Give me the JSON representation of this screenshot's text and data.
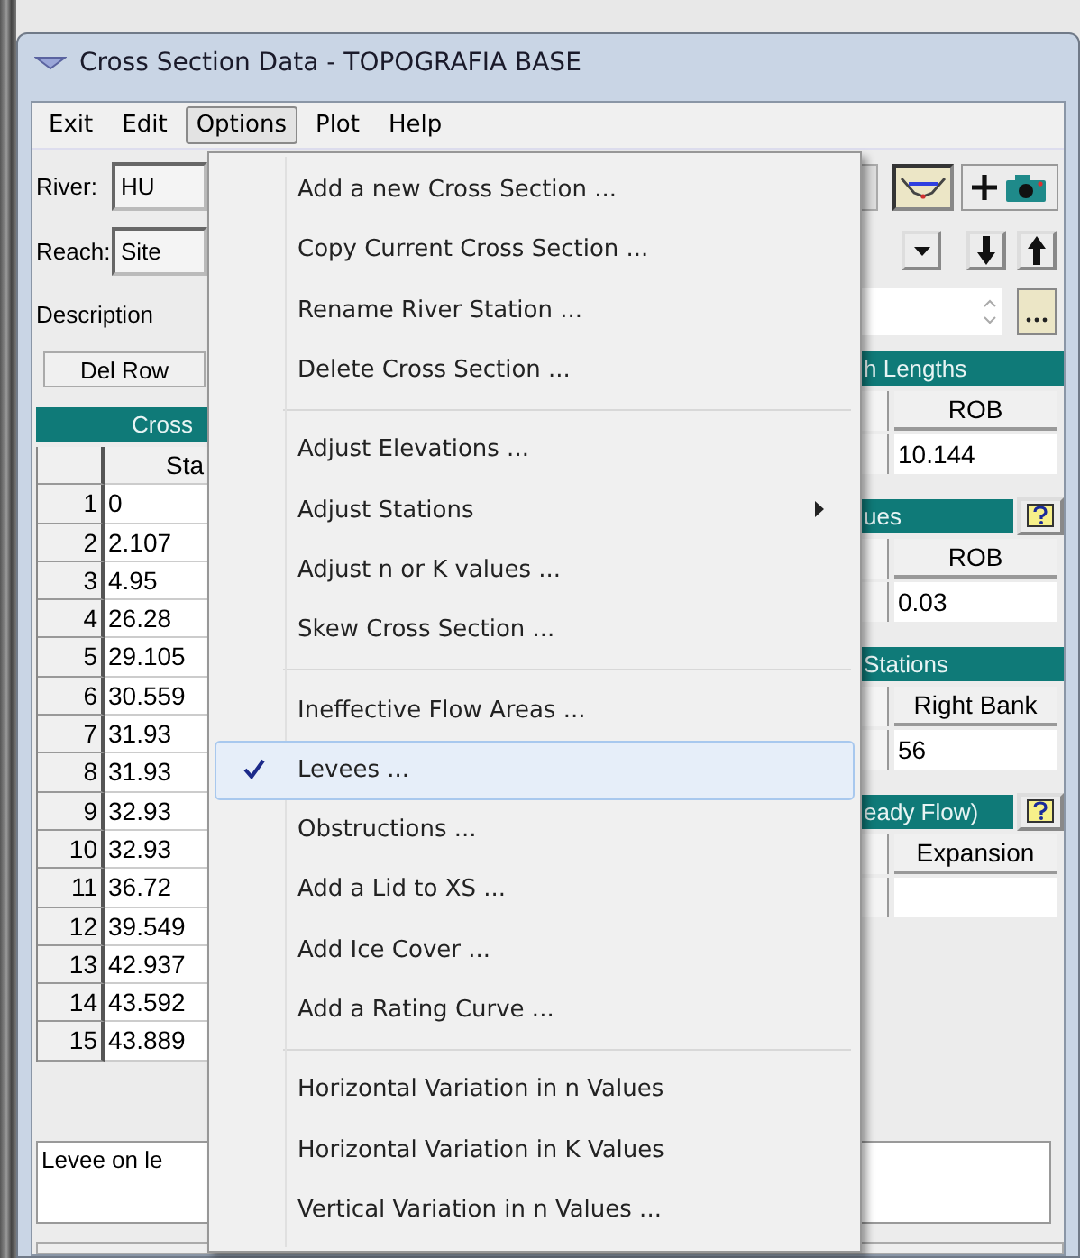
{
  "window": {
    "title": "Cross Section Data - TOPOGRAFIA BASE"
  },
  "menu_bar": [
    {
      "label": "Exit",
      "selected": false
    },
    {
      "label": "Edit",
      "selected": false
    },
    {
      "label": "Options",
      "selected": true
    },
    {
      "label": "Plot",
      "selected": false
    },
    {
      "label": "Help",
      "selected": false
    }
  ],
  "options_menu": {
    "groups": [
      [
        {
          "label": "Add a new Cross Section ...",
          "checked": false,
          "selected": false,
          "submenu": false
        },
        {
          "label": "Copy Current Cross Section ...",
          "checked": false,
          "selected": false,
          "submenu": false
        },
        {
          "label": "Rename River Station ...",
          "checked": false,
          "selected": false,
          "submenu": false
        },
        {
          "label": "Delete Cross Section ...",
          "checked": false,
          "selected": false,
          "submenu": false
        }
      ],
      [
        {
          "label": "Adjust Elevations ...",
          "checked": false,
          "selected": false,
          "submenu": false
        },
        {
          "label": "Adjust Stations",
          "checked": false,
          "selected": false,
          "submenu": true
        },
        {
          "label": "Adjust n or K values ...",
          "checked": false,
          "selected": false,
          "submenu": false
        },
        {
          "label": "Skew Cross Section ...",
          "checked": false,
          "selected": false,
          "submenu": false
        }
      ],
      [
        {
          "label": "Ineffective Flow Areas ...",
          "checked": false,
          "selected": false,
          "submenu": false
        },
        {
          "label": "Levees ...",
          "checked": true,
          "selected": true,
          "submenu": false
        },
        {
          "label": "Obstructions ...",
          "checked": false,
          "selected": false,
          "submenu": false
        },
        {
          "label": "Add a Lid to XS ...",
          "checked": false,
          "selected": false,
          "submenu": false
        },
        {
          "label": "Add Ice Cover ...",
          "checked": false,
          "selected": false,
          "submenu": false
        },
        {
          "label": "Add a Rating Curve ...",
          "checked": false,
          "selected": false,
          "submenu": false
        }
      ],
      [
        {
          "label": "Horizontal Variation in n Values",
          "checked": false,
          "selected": false,
          "submenu": false
        },
        {
          "label": "Horizontal Variation in K Values",
          "checked": false,
          "selected": false,
          "submenu": false
        },
        {
          "label": "Vertical Variation in n Values ...",
          "checked": false,
          "selected": false,
          "submenu": false
        }
      ]
    ]
  },
  "river": {
    "label": "River:",
    "value": "HU"
  },
  "reach": {
    "label": "Reach:",
    "value": "Site"
  },
  "description": {
    "label": "Description"
  },
  "del_row_button": "Del Row",
  "toolbar_buttons": [
    {
      "selected": false
    },
    {
      "selected": true
    },
    {
      "selected": false
    }
  ],
  "cross_section_table": {
    "title": "Cross",
    "column": "Sta",
    "rows": [
      {
        "index": "1",
        "station": "0"
      },
      {
        "index": "2",
        "station": "2.107"
      },
      {
        "index": "3",
        "station": "4.95"
      },
      {
        "index": "4",
        "station": "26.28"
      },
      {
        "index": "5",
        "station": "29.105"
      },
      {
        "index": "6",
        "station": "30.559"
      },
      {
        "index": "7",
        "station": "31.93"
      },
      {
        "index": "8",
        "station": "31.93"
      },
      {
        "index": "9",
        "station": "32.93"
      },
      {
        "index": "10",
        "station": "32.93"
      },
      {
        "index": "11",
        "station": "36.72"
      },
      {
        "index": "12",
        "station": "39.549"
      },
      {
        "index": "13",
        "station": "42.937"
      },
      {
        "index": "14",
        "station": "43.592"
      },
      {
        "index": "15",
        "station": "43.889"
      }
    ]
  },
  "panels": [
    {
      "title": "h Lengths",
      "help": false,
      "column": "ROB",
      "value": "10.144"
    },
    {
      "title": "ues",
      "help": true,
      "column": "ROB",
      "value": "0.03"
    },
    {
      "title": "Stations",
      "help": false,
      "column": "Right Bank",
      "value": "56"
    },
    {
      "title": "eady Flow)",
      "help": true,
      "column": "Expansion"
    }
  ],
  "comment": "Levee on le"
}
